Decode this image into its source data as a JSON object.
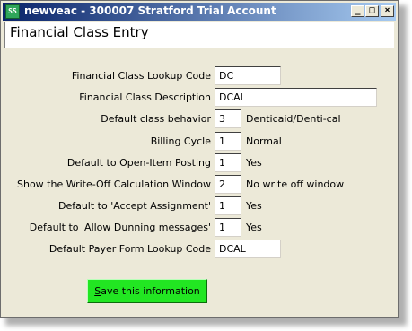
{
  "window": {
    "title": "newveac - 300007 Stratford Trial Account",
    "icon_label": "SS",
    "minimize": "_",
    "maximize": "□",
    "close": "×"
  },
  "header": {
    "title": "Financial Class Entry"
  },
  "form": {
    "rows": [
      {
        "label": "Financial Class Lookup Code",
        "value": "DC",
        "desc": ""
      },
      {
        "label": "Financial Class Description",
        "value": "DCAL",
        "desc": ""
      },
      {
        "label": "Default class behavior",
        "value": "3",
        "desc": "Denticaid/Denti-cal"
      },
      {
        "label": "Billing Cycle",
        "value": "1",
        "desc": "Normal"
      },
      {
        "label": "Default to Open-Item Posting",
        "value": "1",
        "desc": "Yes"
      },
      {
        "label": "Show the Write-Off Calculation Window",
        "value": "2",
        "desc": "No write off window"
      },
      {
        "label": "Default to 'Accept Assignment'",
        "value": "1",
        "desc": "Yes"
      },
      {
        "label": "Default to 'Allow Dunning messages'",
        "value": "1",
        "desc": "Yes"
      },
      {
        "label": "Default Payer Form Lookup Code",
        "value": "DCAL",
        "desc": ""
      }
    ]
  },
  "save_button": {
    "mnemonic": "S",
    "rest": "ave this information"
  },
  "colors": {
    "titlebar": "#0a246a",
    "save": "#22e622",
    "window": "#ece9d8"
  }
}
